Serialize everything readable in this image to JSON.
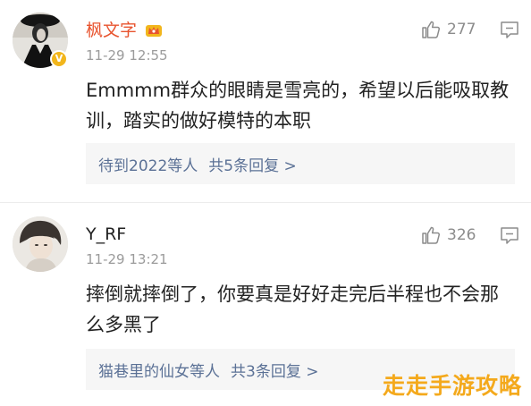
{
  "comments": [
    {
      "username": "枫文字",
      "time": "11-29 12:55",
      "likes": "277",
      "text": "Emmmm群众的眼睛是雪亮的，希望以后能吸取教训，踏实的做好模特的本职",
      "reply_author": "待到2022等人",
      "reply_count": "共5条回复 >",
      "name_color": "#e8542f"
    },
    {
      "username": "Y_RF",
      "time": "11-29 13:21",
      "likes": "326",
      "text": "摔倒就摔倒了，你要真是好好走完后半程也不会那么多黑了",
      "reply_author": "猫巷里的仙女等人",
      "reply_count": "共3条回复 >",
      "name_color": "#222222"
    }
  ],
  "watermark": "走走手游攻略",
  "colors": {
    "reply_link": "#5b7196",
    "watermark": "#f4a91c",
    "vip_badge": "#f2b61c"
  }
}
